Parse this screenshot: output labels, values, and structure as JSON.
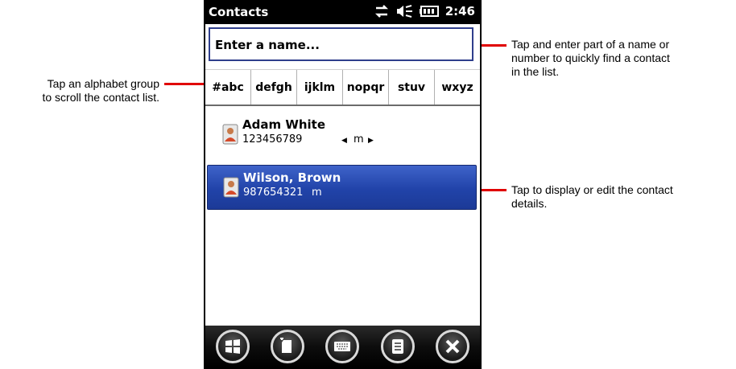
{
  "statusbar": {
    "title": "Contacts",
    "time": "2:46"
  },
  "search": {
    "placeholder": "Enter a name..."
  },
  "alphabet_groups": [
    "#abc",
    "defgh",
    "ijklm",
    "nopqr",
    "stuv",
    "wxyz"
  ],
  "contacts": [
    {
      "name": "Adam White",
      "number": "123456789",
      "type": "m",
      "selected": false
    },
    {
      "name": "Wilson, Brown",
      "number": "987654321",
      "type": "m",
      "selected": true
    }
  ],
  "toolbar": [
    "start-icon",
    "new-contact-icon",
    "keyboard-icon",
    "menu-icon",
    "close-icon"
  ],
  "callouts": {
    "alpha_line1": "Tap an alphabet group",
    "alpha_line2": "to scroll the contact list.",
    "search_line1": "Tap and enter part of a name or",
    "search_line2": "number to quickly find a contact",
    "search_line3": "in the list.",
    "contact_line1": "Tap to display or edit the contact",
    "contact_line2": "details."
  },
  "colors": {
    "callout_line": "#e00000",
    "selected_row": "#2a4bb3",
    "search_border": "#2f3e8c"
  }
}
